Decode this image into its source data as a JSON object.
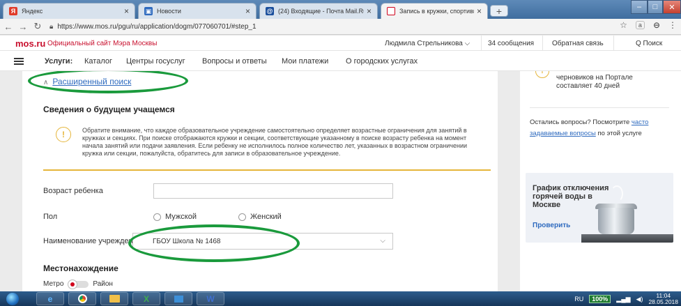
{
  "browser": {
    "tabs": [
      {
        "title": "Яндекс",
        "favicon": "Я",
        "color": "#e03b2a"
      },
      {
        "title": "Новости",
        "favicon": "▣",
        "color": "#2f6bbf"
      },
      {
        "title": "(24) Входящие - Почта Mail.Ru",
        "favicon": "@",
        "color": "#1b4f9c"
      },
      {
        "title": "Запись в кружки, спортивные с",
        "favicon": "",
        "color": "#d0021b"
      }
    ],
    "url": "https://www.mos.ru/pgu/ru/application/dogm/077060701/#step_1"
  },
  "site_header": {
    "logo": "mos.ru",
    "site_name": "Официальный сайт Мэра Москвы",
    "user": "Людмила Стрельникова ⌵",
    "messages": "34 сообщения",
    "feedback": "Обратная связь",
    "search": "Q Поиск"
  },
  "services_nav": {
    "label": "Услуги:",
    "items": [
      "Каталог",
      "Центры госуслуг",
      "Вопросы и ответы",
      "Мои платежи",
      "О городских услугах"
    ]
  },
  "form": {
    "advanced_search": "Расширенный поиск",
    "section_title": "Сведения о будущем учащемся",
    "notice": "Обратите внимание, что каждое образовательное учреждение самостоятельно определяет возрастные ограничения для занятий в кружках и секциях. При поиске отображаются кружки и секции, соответствующие указанному в поиске возрасту ребенка на момент начала занятий или подачи заявления. Если ребенку не исполнилось полное количество лет, указанных в возрастном ограничении кружка или секции, пожалуйста, обратитесь для записи в образовательное учреждение.",
    "age_label": "Возраст ребенка",
    "gender_label": "Пол",
    "gender_options": [
      "Мужской",
      "Женский"
    ],
    "institution_label": "Наименование учреждения",
    "institution_value": "ГБОУ Школа № 1468",
    "location_title": "Местонахождение",
    "metro": "Метро",
    "district": "Район"
  },
  "sidebar": {
    "drafts_text": "черновиков на Портале составляет 40 дней",
    "questions_prefix": "Остались вопросы? Посмотрите ",
    "faq_link": "часто задаваемые вопросы",
    "questions_suffix": " по этой услуге",
    "banner_title": "График отключения горячей воды в Москве",
    "banner_link": "Проверить"
  },
  "taskbar": {
    "lang": "RU",
    "battery": "100%",
    "time": "11:04",
    "date": "28.05.2018"
  },
  "colors": {
    "accent": "#2f6bbf",
    "brand": "#c8102e",
    "annotation": "#1a9a3c",
    "warning": "#e5b53a"
  }
}
